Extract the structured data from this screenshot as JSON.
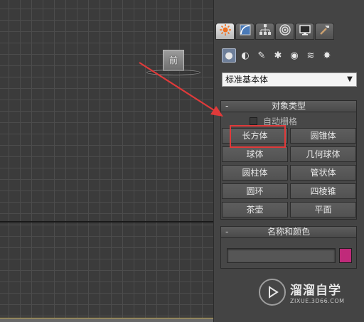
{
  "viewport": {
    "viewcube_label": "前"
  },
  "command_panel": {
    "tabs": [
      {
        "icon": "create-icon",
        "active": true
      },
      {
        "icon": "modify-icon",
        "active": false
      },
      {
        "icon": "hierarchy-icon",
        "active": false
      },
      {
        "icon": "motion-icon",
        "active": false
      },
      {
        "icon": "display-icon",
        "active": false
      },
      {
        "icon": "utilities-icon",
        "active": false
      }
    ],
    "subcategories": [
      {
        "icon": "geometry-icon",
        "active": true
      },
      {
        "icon": "shapes-icon",
        "active": false
      },
      {
        "icon": "lights-icon",
        "active": false
      },
      {
        "icon": "cameras-icon",
        "active": false
      },
      {
        "icon": "helpers-icon",
        "active": false
      },
      {
        "icon": "spacewarps-icon",
        "active": false
      },
      {
        "icon": "systems-icon",
        "active": false
      }
    ],
    "category_dropdown": {
      "value": "标准基本体"
    },
    "object_type": {
      "title": "对象类型",
      "toggle": "-",
      "autogrid_label": "自动栅格",
      "buttons": [
        "长方体",
        "圆锥体",
        "球体",
        "几何球体",
        "圆柱体",
        "管状体",
        "圆环",
        "四棱锥",
        "茶壶",
        "平面"
      ]
    },
    "name_color": {
      "title": "名称和颜色",
      "toggle": "-",
      "name_value": "",
      "swatch_color": "#c02a7a"
    }
  },
  "annotation": {
    "highlight_color": "#e03a3a"
  },
  "watermark": {
    "main": "溜溜自学",
    "sub": "ZIXUE.3D66.COM"
  }
}
